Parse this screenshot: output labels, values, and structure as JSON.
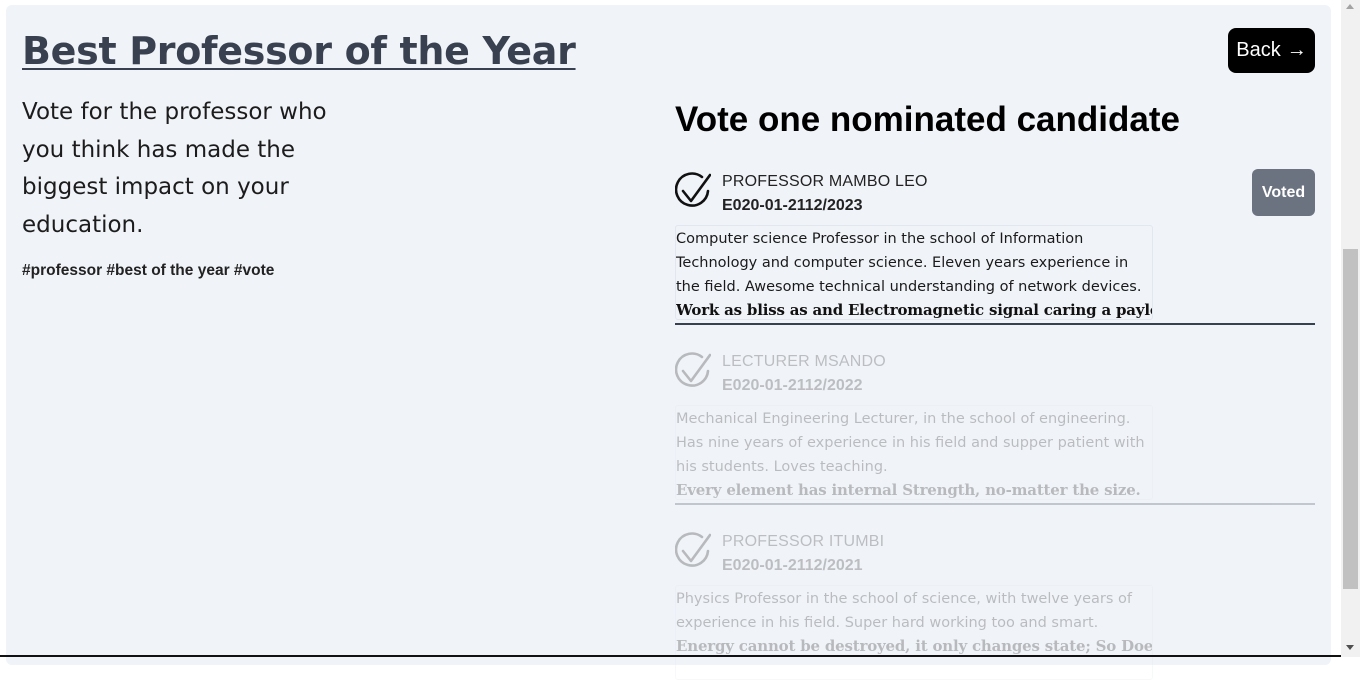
{
  "header": {
    "title": "Best Professor of the Year",
    "back_label": "Back",
    "back_icon": "arrow-right-icon"
  },
  "intro": {
    "description": "Vote for the professor who you think has made the biggest impact on your education.",
    "tags": "#professor #best of the year #vote"
  },
  "section": {
    "title": "Vote one nominated candidate"
  },
  "candidates": [
    {
      "name": "PROFESSOR MAMBO LEO",
      "id": "E020-01-2112/2023",
      "bio": "Computer science Professor in the school of Information Technology and computer science. Eleven years experience in the field. Awesome technical understanding of network devices.",
      "quote": "Work as bliss as and Electromagnetic signal caring a payload!.",
      "voted_label": "Voted",
      "status": "voted"
    },
    {
      "name": "LECTURER MSANDO",
      "id": "E020-01-2112/2022",
      "bio": "Mechanical Engineering Lecturer, in the school of engineering. Has nine years of experience in his field and supper patient with his students. Loves teaching.",
      "quote": "Every element has internal Strength, no-matter the size.",
      "status": "disabled"
    },
    {
      "name": "PROFESSOR ITUMBI",
      "id": "E020-01-2112/2021",
      "bio": "Physics Professor in the school of science, with twelve years of experience in his field. Super hard working too and smart.",
      "quote": "Energy cannot be destroyed, it only changes state; So Does",
      "status": "disabled"
    }
  ],
  "colors": {
    "panel_bg": "#f0f3f8",
    "title": "#394150",
    "voted_button": "#6b7280",
    "back_button": "#000000"
  }
}
